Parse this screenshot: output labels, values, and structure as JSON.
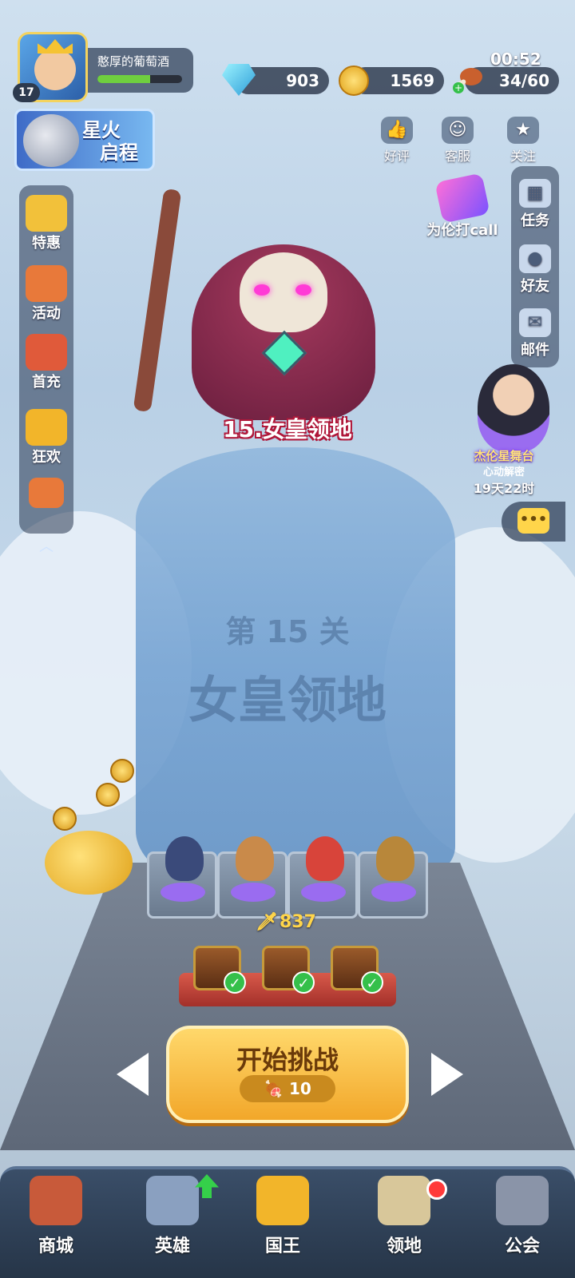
{
  "player": {
    "level": "17",
    "name": "憨厚的葡萄酒",
    "xp_progress": 0.62
  },
  "resources": {
    "gems": "903",
    "coins": "1569",
    "stamina": "34/60",
    "stamina_timer": "00:52"
  },
  "event_banner": {
    "title_line1": "星火",
    "title_line2": "启程"
  },
  "top_actions": [
    {
      "label": "好评",
      "icon": "thumbs-up-icon",
      "glyph": "👍"
    },
    {
      "label": "客服",
      "icon": "headset-icon",
      "glyph": "☺"
    },
    {
      "label": "关注",
      "icon": "star-icon",
      "glyph": "★"
    }
  ],
  "left_sidebar": [
    {
      "label": "特惠",
      "icon": "gift-icon",
      "color": "#f2c13a"
    },
    {
      "label": "活动",
      "icon": "fireworks-icon",
      "color": "#e8793a"
    },
    {
      "label": "首充",
      "icon": "hero-sword-icon",
      "color": "#e05a3a"
    },
    {
      "label": "狂欢",
      "icon": "treasure-chest-icon",
      "color": "#f2b52a"
    }
  ],
  "left_sidebar_extra_icon": "crown-icon",
  "callout": {
    "label": "为伦打call",
    "icon": "lightstick-icon"
  },
  "right_sidebar": [
    {
      "label": "任务",
      "icon": "calendar-icon",
      "glyph": "▦"
    },
    {
      "label": "好友",
      "icon": "friends-icon",
      "glyph": "●"
    },
    {
      "label": "邮件",
      "icon": "mail-icon",
      "glyph": "✉"
    }
  ],
  "promo": {
    "title": "杰伦星舞台",
    "subtitle": "心动解密",
    "timer": "19天22时"
  },
  "chat": {
    "glyph": "•••"
  },
  "stage": {
    "boss_label": "15.女皇领地",
    "watermark_chapter": "第 15 关",
    "watermark_name": "女皇领地"
  },
  "team": {
    "power": "837",
    "heroes": [
      {
        "icon": "ninja-hero-icon",
        "color": "#3a4a7a"
      },
      {
        "icon": "raccoon-hero-icon",
        "color": "#c98a4a"
      },
      {
        "icon": "red-fox-hero-icon",
        "color": "#d8443a"
      },
      {
        "icon": "miner-hero-icon",
        "color": "#b8873a"
      }
    ]
  },
  "chests": [
    {
      "icon": "chest-icon",
      "claimed": true
    },
    {
      "icon": "chest-icon",
      "claimed": true
    },
    {
      "icon": "chest-icon",
      "claimed": true
    }
  ],
  "start": {
    "label": "开始挑战",
    "cost": "10"
  },
  "bottom_nav": [
    {
      "label": "商城",
      "icon": "shop-icon",
      "color": "#c85a3a"
    },
    {
      "label": "英雄",
      "icon": "helmet-icon",
      "color": "#8aa0c0"
    },
    {
      "label": "国王",
      "icon": "crown-icon",
      "color": "#f2b52a"
    },
    {
      "label": "领地",
      "icon": "castle-icon",
      "color": "#d8c79a"
    },
    {
      "label": "公会",
      "icon": "lock-icon",
      "color": "#8a94a8"
    }
  ],
  "colors": {
    "accent_gold": "#f2a72a",
    "xp_green": "#6fcf3f",
    "badge_red": "#ff3a3a"
  }
}
